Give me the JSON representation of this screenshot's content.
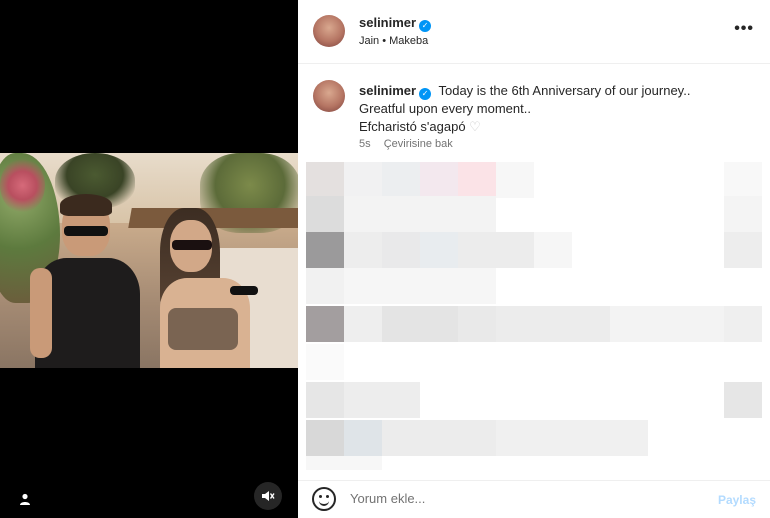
{
  "header": {
    "username": "selinimer",
    "subtitle": "Jain • Makeba",
    "more_label": "•••"
  },
  "caption": {
    "username": "selinimer",
    "line1": "Today is the 6th Anniversary of our journey..",
    "line2": "Greatful upon every moment..",
    "line3": "Efcharistó s'agapó",
    "heart_icon": "♡",
    "time": "5s",
    "translate_label": "Çevirisine bak"
  },
  "comment": {
    "placeholder": "Yorum ekle...",
    "post_label": "Paylaş"
  },
  "icons": {
    "user": "user-icon",
    "mute": "speaker-muted-icon",
    "emoji": "emoji-icon",
    "verified": "verified-badge-icon",
    "verified_color": "#0095f6"
  }
}
